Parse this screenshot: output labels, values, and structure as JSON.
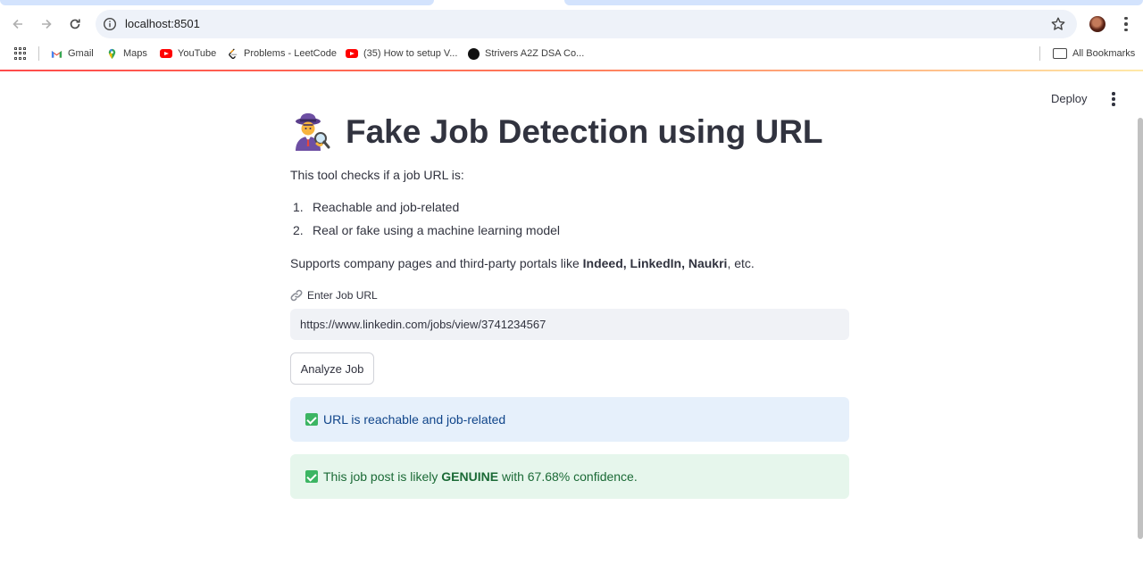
{
  "browser": {
    "url": "localhost:8501",
    "bookmarks": [
      {
        "label": "Gmail",
        "icon": "gmail-icon"
      },
      {
        "label": "Maps",
        "icon": "maps-icon"
      },
      {
        "label": "YouTube",
        "icon": "youtube-icon"
      },
      {
        "label": "Problems - LeetCode",
        "icon": "leetcode-icon"
      },
      {
        "label": "(35) How to setup V...",
        "icon": "youtube-icon"
      },
      {
        "label": "Strivers A2Z DSA Co...",
        "icon": "takeuforward-icon"
      }
    ],
    "all_bookmarks": "All Bookmarks"
  },
  "app": {
    "deploy_label": "Deploy",
    "title": "Fake Job Detection using URL",
    "intro": "This tool checks if a job URL is:",
    "checks": [
      {
        "num": "1.",
        "text": "Reachable and job-related"
      },
      {
        "num": "2.",
        "text": "Real or fake using a machine learning model"
      }
    ],
    "supports": {
      "prefix": "Supports company pages and third-party portals like ",
      "portals": "Indeed, LinkedIn, Naukri",
      "suffix": ", etc."
    },
    "input": {
      "label": "Enter Job URL",
      "value": "https://www.linkedin.com/jobs/view/3741234567"
    },
    "analyze_button": "Analyze Job",
    "info_alert": "URL is reachable and job-related",
    "result": {
      "prefix": "This job post is likely ",
      "verdict": "GENUINE",
      "suffix": " with 67.68% confidence."
    }
  },
  "colors": {
    "accent": "#ff4b4b",
    "info_bg": "#e6f0fb",
    "info_text": "#10458a",
    "success_bg": "#e6f6ec",
    "success_text": "#1b6a36"
  }
}
